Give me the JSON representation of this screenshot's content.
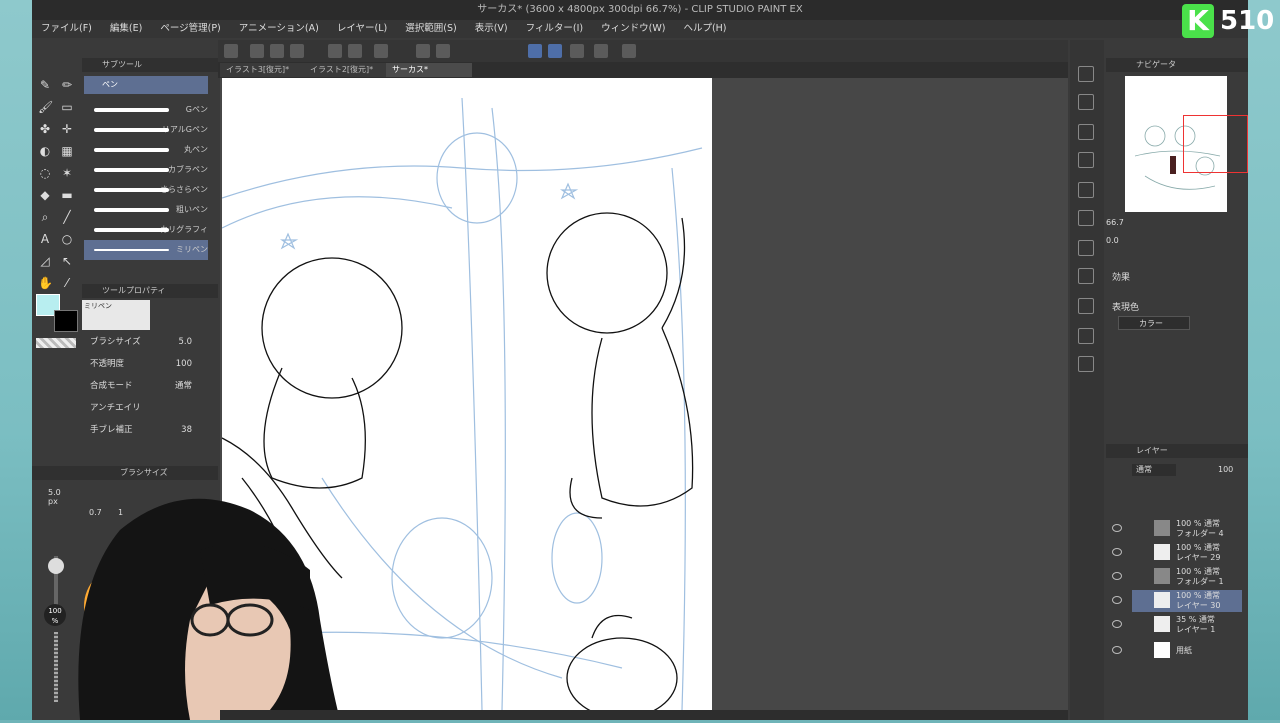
{
  "app": {
    "title": "サーカス* (3600 x 4800px 300dpi 66.7%) - CLIP STUDIO PAINT EX"
  },
  "menu": [
    "ファイル(F)",
    "編集(E)",
    "ページ管理(P)",
    "アニメーション(A)",
    "レイヤー(L)",
    "選択範囲(S)",
    "表示(V)",
    "フィルター(I)",
    "ウィンドウ(W)",
    "ヘルプ(H)"
  ],
  "tabs": [
    "イラスト3[復元]*",
    "イラスト2[復元]*",
    "サーカス*"
  ],
  "subtool": {
    "header": "サブツール",
    "group": "ペン",
    "brushes": [
      "Gペン",
      "リアルGペン",
      "丸ペン",
      "カブラペン",
      "さらさらペン",
      "粗いペン",
      "カリグラフィ",
      "ミリペン"
    ]
  },
  "toolprop": {
    "header": "ツールプロパティ",
    "current_brush": "ミリペン",
    "brush_size_label": "ブラシサイズ",
    "brush_size": "5.0",
    "opacity_label": "不透明度",
    "opacity": "100",
    "blend_label": "合成モード",
    "blend": "通常",
    "aa_label": "アンチエイリ",
    "stabilize_label": "手ブレ補正",
    "stabilize": "38"
  },
  "brushsize_panel": {
    "header": "ブラシサイズ",
    "size_value": "5.0",
    "size_unit": "px",
    "presets": [
      "0.7",
      "1"
    ],
    "opacity_value": "100",
    "opacity_unit": "%"
  },
  "navigator": {
    "header": "ナビゲータ",
    "zoom": "66.7",
    "rotate": "0.0"
  },
  "effects": {
    "header": "効果",
    "expr_label": "表現色",
    "expr_value": "カラー"
  },
  "layers": {
    "header": "レイヤー",
    "blend": "通常",
    "opacity": "100",
    "items": [
      {
        "mode": "100 % 通常",
        "name": "フォルダー 4"
      },
      {
        "mode": "100 % 通常",
        "name": "レイヤー 29"
      },
      {
        "mode": "100 % 通常",
        "name": "フォルダー 1"
      },
      {
        "mode": "100 % 通常",
        "name": "レイヤー 30"
      },
      {
        "mode": "35 % 通常",
        "name": "レイヤー 1"
      },
      {
        "mode": "",
        "name": "用紙"
      }
    ]
  },
  "stream": {
    "logo": "K",
    "count": "510"
  },
  "colors": {
    "main": "#b8eef0",
    "sub": "#000000",
    "accent": "#5e6f92"
  }
}
